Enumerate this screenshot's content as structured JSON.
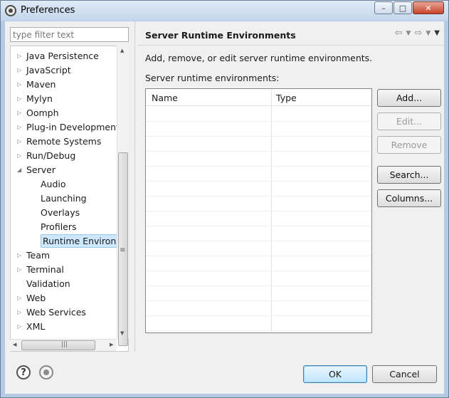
{
  "window": {
    "title": "Preferences",
    "minimize_glyph": "–",
    "maximize_glyph": "□",
    "close_glyph": "✕"
  },
  "sidebar": {
    "filter_placeholder": "type filter text",
    "items": [
      {
        "label": "Java Persistence",
        "expandable": true,
        "level": 0
      },
      {
        "label": "JavaScript",
        "expandable": true,
        "level": 0
      },
      {
        "label": "Maven",
        "expandable": true,
        "level": 0
      },
      {
        "label": "Mylyn",
        "expandable": true,
        "level": 0
      },
      {
        "label": "Oomph",
        "expandable": true,
        "level": 0
      },
      {
        "label": "Plug-in Development",
        "expandable": true,
        "level": 0
      },
      {
        "label": "Remote Systems",
        "expandable": true,
        "level": 0
      },
      {
        "label": "Run/Debug",
        "expandable": true,
        "level": 0
      },
      {
        "label": "Server",
        "expandable": true,
        "expanded": true,
        "level": 0
      },
      {
        "label": "Audio",
        "expandable": false,
        "level": 1
      },
      {
        "label": "Launching",
        "expandable": false,
        "level": 1
      },
      {
        "label": "Overlays",
        "expandable": false,
        "level": 1
      },
      {
        "label": "Profilers",
        "expandable": false,
        "level": 1
      },
      {
        "label": "Runtime Environm",
        "expandable": false,
        "level": 1,
        "selected": true
      },
      {
        "label": "Team",
        "expandable": true,
        "level": 0
      },
      {
        "label": "Terminal",
        "expandable": true,
        "level": 0
      },
      {
        "label": "Validation",
        "expandable": false,
        "level": 0
      },
      {
        "label": "Web",
        "expandable": true,
        "level": 0
      },
      {
        "label": "Web Services",
        "expandable": true,
        "level": 0
      },
      {
        "label": "XML",
        "expandable": true,
        "level": 0
      }
    ]
  },
  "page": {
    "title": "Server Runtime Environments",
    "description": "Add, remove, or edit server runtime environments.",
    "list_label": "Server runtime environments:",
    "table": {
      "columns": [
        "Name",
        "Type"
      ],
      "rows": []
    },
    "buttons": {
      "add": "Add...",
      "edit": "Edit...",
      "remove": "Remove",
      "search": "Search...",
      "columns": "Columns..."
    }
  },
  "footer": {
    "ok": "OK",
    "cancel": "Cancel",
    "help_glyph": "?"
  },
  "colors": {
    "selection": "#cde8ff",
    "selection_border": "#99c9f3",
    "ok_border": "#3c7fb1"
  }
}
